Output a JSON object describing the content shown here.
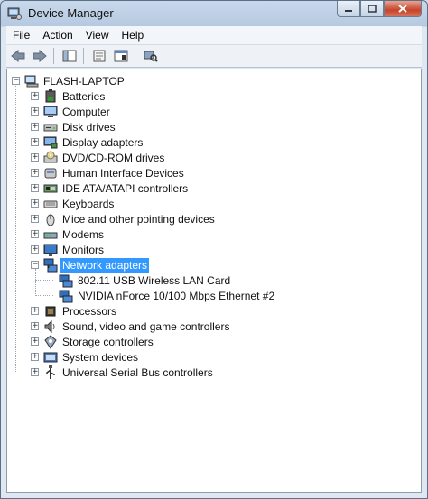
{
  "window": {
    "title": "Device Manager"
  },
  "menu": [
    "File",
    "Action",
    "View",
    "Help"
  ],
  "toolbar": {
    "buttons": [
      "back-icon",
      "forward-icon",
      "show-hide-console-tree-icon",
      "properties-icon",
      "help-icon",
      "scan-hardware-icon"
    ]
  },
  "tree": {
    "root": "FLASH-LAPTOP",
    "categories": [
      {
        "label": "Batteries",
        "icon": "battery-icon",
        "expanded": false
      },
      {
        "label": "Computer",
        "icon": "computer-icon",
        "expanded": false
      },
      {
        "label": "Disk drives",
        "icon": "disk-drive-icon",
        "expanded": false
      },
      {
        "label": "Display adapters",
        "icon": "display-adapter-icon",
        "expanded": false
      },
      {
        "label": "DVD/CD-ROM drives",
        "icon": "dvd-drive-icon",
        "expanded": false
      },
      {
        "label": "Human Interface Devices",
        "icon": "hid-icon",
        "expanded": false
      },
      {
        "label": "IDE ATA/ATAPI controllers",
        "icon": "ide-controller-icon",
        "expanded": false
      },
      {
        "label": "Keyboards",
        "icon": "keyboard-icon",
        "expanded": false
      },
      {
        "label": "Mice and other pointing devices",
        "icon": "mouse-icon",
        "expanded": false
      },
      {
        "label": "Modems",
        "icon": "modem-icon",
        "expanded": false
      },
      {
        "label": "Monitors",
        "icon": "monitor-icon",
        "expanded": false
      },
      {
        "label": "Network adapters",
        "icon": "network-adapter-icon",
        "expanded": true,
        "selected": true,
        "children": [
          "802.11 USB Wireless LAN Card",
          "NVIDIA nForce 10/100 Mbps Ethernet #2"
        ]
      },
      {
        "label": "Processors",
        "icon": "processor-icon",
        "expanded": false
      },
      {
        "label": "Sound, video and game controllers",
        "icon": "sound-icon",
        "expanded": false
      },
      {
        "label": "Storage controllers",
        "icon": "storage-controller-icon",
        "expanded": false
      },
      {
        "label": "System devices",
        "icon": "system-device-icon",
        "expanded": false
      },
      {
        "label": "Universal Serial Bus controllers",
        "icon": "usb-icon",
        "expanded": false
      }
    ]
  },
  "colors": {
    "selection": "#3399ff",
    "title_bar": "#c9d9ec",
    "close_button": "#c6442a"
  }
}
